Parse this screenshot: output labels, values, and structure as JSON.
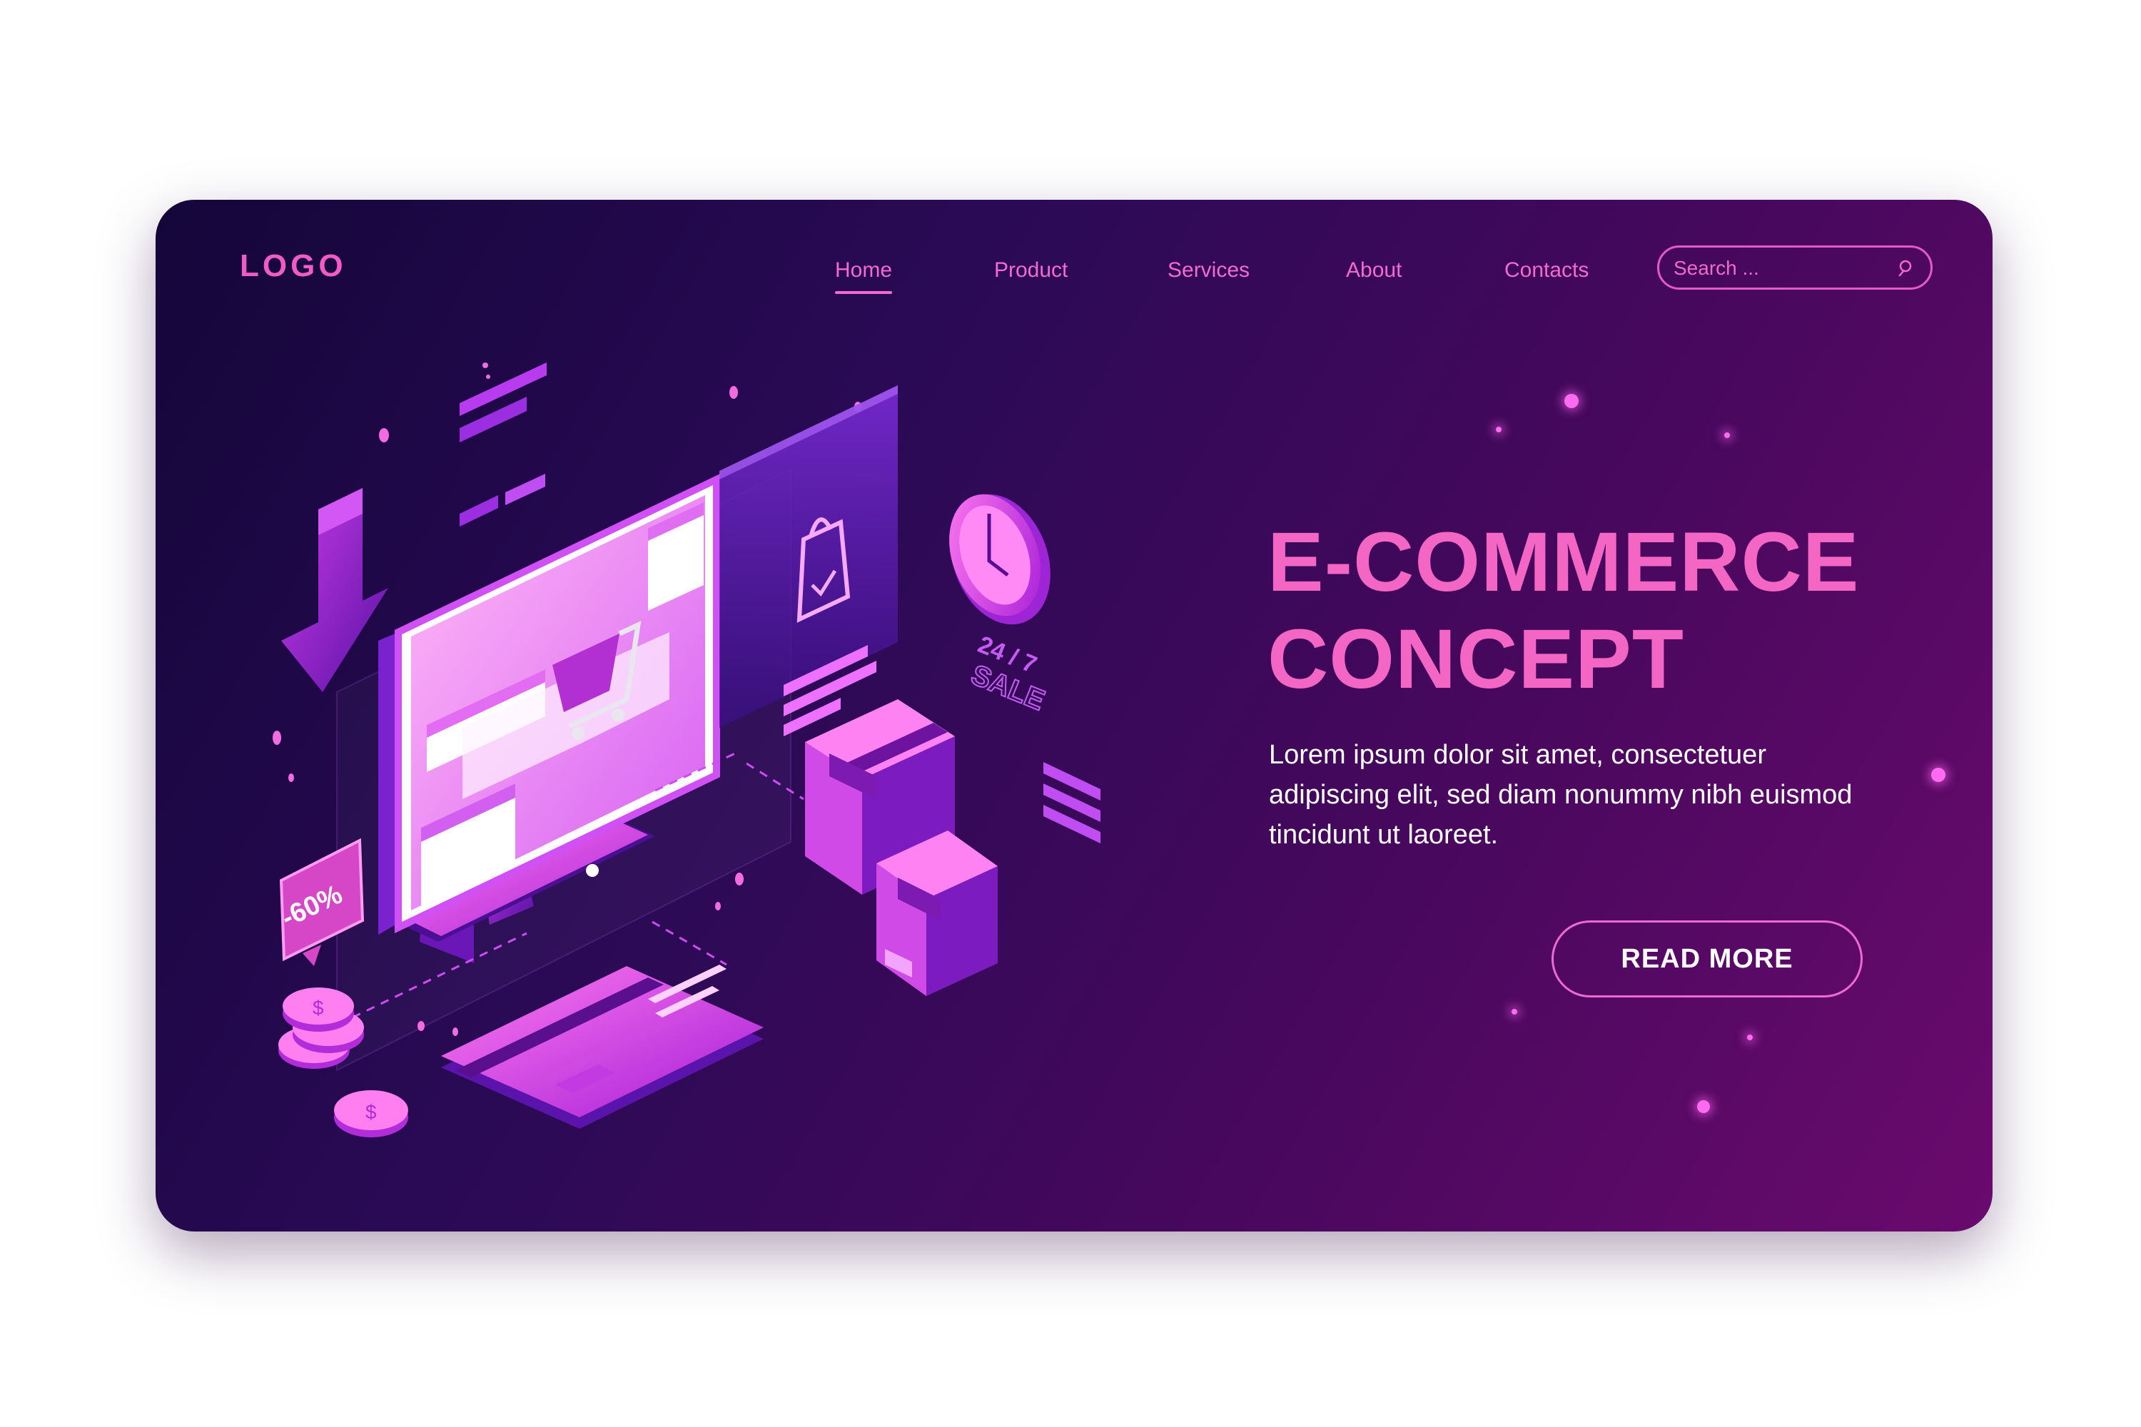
{
  "header": {
    "logo": "LOGO",
    "nav": [
      {
        "label": "Home",
        "active": true
      },
      {
        "label": "Product",
        "active": false
      },
      {
        "label": "Services",
        "active": false
      },
      {
        "label": "About",
        "active": false
      },
      {
        "label": "Contacts",
        "active": false
      }
    ],
    "search": {
      "placeholder": "Search ...",
      "value": ""
    }
  },
  "hero": {
    "title_line1": "E-COMMERCE",
    "title_line2": "CONCEPT",
    "description": "Lorem ipsum dolor sit amet, consectetuer adipiscing elit, sed diam nonummy nibh euismod tincidunt ut laoreet.",
    "cta_label": "READ MORE"
  },
  "illustration": {
    "discount_badge": "-60%",
    "sale_label_top": "24 / 7",
    "sale_label_bottom": "SALE"
  },
  "colors": {
    "accent": "#f466c4",
    "bg_dark": "#14063a",
    "bg_light": "#6a0a6e"
  }
}
